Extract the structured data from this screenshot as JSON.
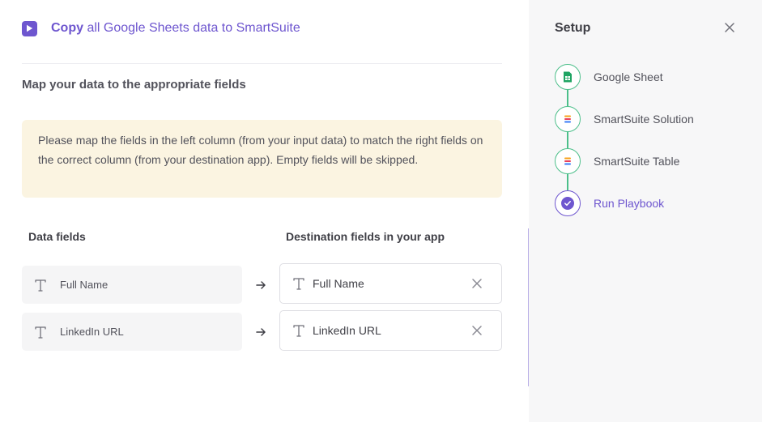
{
  "header": {
    "action_word": "Copy",
    "title_rest": " all Google Sheets data to SmartSuite"
  },
  "section_title": "Map your data to the appropriate fields",
  "notice": "Please map the fields in the left column (from your input data) to match the right fields on the correct column (from your destination app). Empty fields will be skipped.",
  "columns": {
    "left": "Data fields",
    "right": "Destination fields in your app"
  },
  "mappings": [
    {
      "source": "Full Name",
      "destination": "Full Name"
    },
    {
      "source": "LinkedIn URL",
      "destination": "LinkedIn URL"
    }
  ],
  "sidebar": {
    "title": "Setup",
    "steps": [
      {
        "label": "Google Sheet",
        "icon": "google-sheets-icon",
        "status": "done"
      },
      {
        "label": "SmartSuite Solution",
        "icon": "smartsuite-icon",
        "status": "done"
      },
      {
        "label": "SmartSuite Table",
        "icon": "smartsuite-icon",
        "status": "done"
      },
      {
        "label": "Run Playbook",
        "icon": "check-circle-icon",
        "status": "active"
      }
    ]
  },
  "colors": {
    "accent": "#6e56cf",
    "success": "#4cbf8a",
    "notice_bg": "#fbf4e1",
    "sidebar_bg": "#f7f7f8"
  }
}
